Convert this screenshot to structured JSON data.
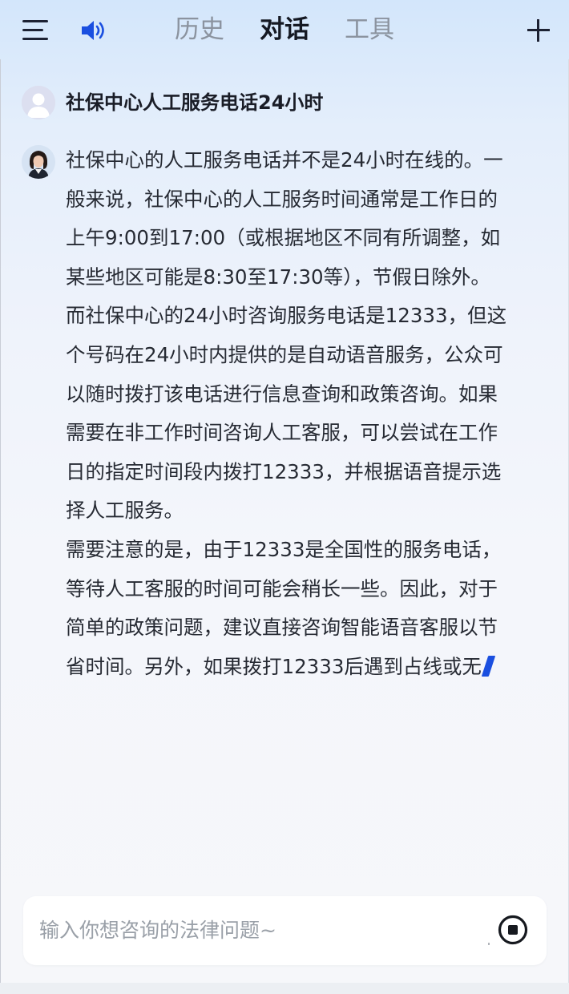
{
  "header": {
    "tabs": [
      {
        "label": "历史",
        "active": false
      },
      {
        "label": "对话",
        "active": true
      },
      {
        "label": "工具",
        "active": false
      }
    ],
    "icons": {
      "menu": "menu-icon",
      "speaker": "speaker-icon",
      "add": "plus-icon"
    },
    "accent_color": "#1a4fe0"
  },
  "conversation": {
    "question": "社保中心人工服务电话24小时",
    "answer_lines": [
      "社保中心的人工服务电话并不是24小时在线的。一",
      "般来说，社保中心的人工服务时间通常是工作日的",
      "上午9:00到17:00（或根据地区不同有所调整，如",
      "某些地区可能是8:30至17:30等），节假日除外。",
      "而社保中心的24小时咨询服务电话是12333，但这",
      "个号码在24小时内提供的是自动语音服务，公众可",
      "以随时拨打该电话进行信息查询和政策咨询。如果",
      "需要在非工作时间咨询人工客服，可以尝试在工作",
      "日的指定时间段内拨打12333，并根据语音提示选",
      "择人工服务。",
      "需要注意的是，由于12333是全国性的服务电话，",
      "等待人工客服的时间可能会稍长一些。因此，对于",
      "简单的政策问题，建议直接咨询智能语音客服以节",
      "省时间。另外，如果拨打12333后遇到占线或无"
    ],
    "streaming": true
  },
  "input": {
    "placeholder": "输入你想咨询的法律问题~",
    "value": "",
    "stop_icon": "stop-icon"
  }
}
